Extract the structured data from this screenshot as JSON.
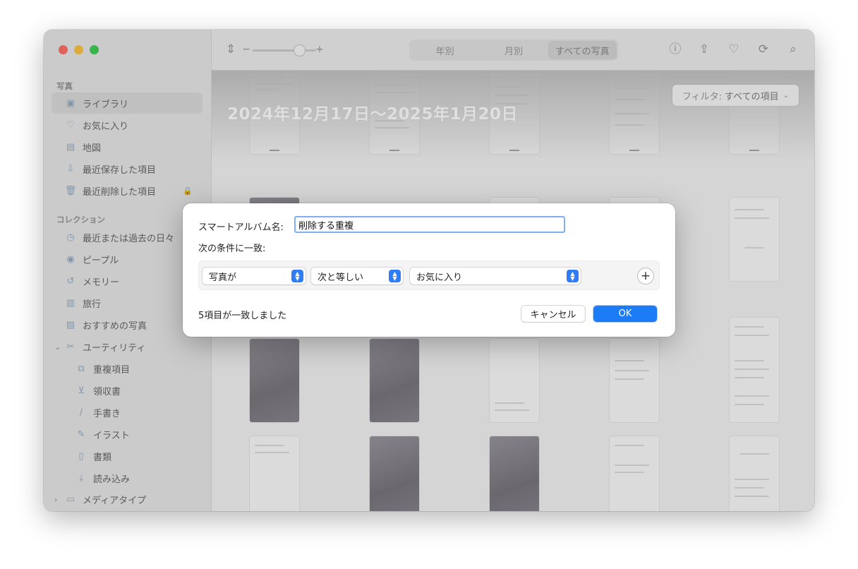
{
  "sidebar": {
    "sections": {
      "photos": "写真",
      "collections": "コレクション"
    },
    "items": [
      {
        "label": "ライブラリ"
      },
      {
        "label": "お気に入り"
      },
      {
        "label": "地図"
      },
      {
        "label": "最近保存した項目"
      },
      {
        "label": "最近削除した項目"
      },
      {
        "label": "最近または過去の日々"
      },
      {
        "label": "ピープル"
      },
      {
        "label": "メモリー"
      },
      {
        "label": "旅行"
      },
      {
        "label": "おすすめの写真"
      },
      {
        "label": "ユーティリティ"
      },
      {
        "label": "重複項目"
      },
      {
        "label": "領収書"
      },
      {
        "label": "手書き"
      },
      {
        "label": "イラスト"
      },
      {
        "label": "書類"
      },
      {
        "label": "読み込み"
      },
      {
        "label": "メディアタイプ"
      }
    ]
  },
  "toolbar": {
    "segments": [
      "年別",
      "月別",
      "すべての写真"
    ],
    "active_segment": "すべての写真",
    "zoom_minus": "−",
    "zoom_plus": "+"
  },
  "content": {
    "date_range": "2024年12月17日〜2025年1月20日",
    "filter_label": "フィルタ:",
    "filter_value": "すべての項目"
  },
  "dialog": {
    "name_label": "スマートアルバム名:",
    "name_value": "削除する重複",
    "match_label": "次の条件に一致:",
    "rule": {
      "field": "写真が",
      "operator": "次と等しい",
      "value": "お気に入り"
    },
    "match_count": "5項目が一致しました",
    "cancel_label": "キャンセル",
    "ok_label": "OK"
  },
  "colors": {
    "accent": "#1b7cf5",
    "focus_ring": "#7fb0f5"
  }
}
